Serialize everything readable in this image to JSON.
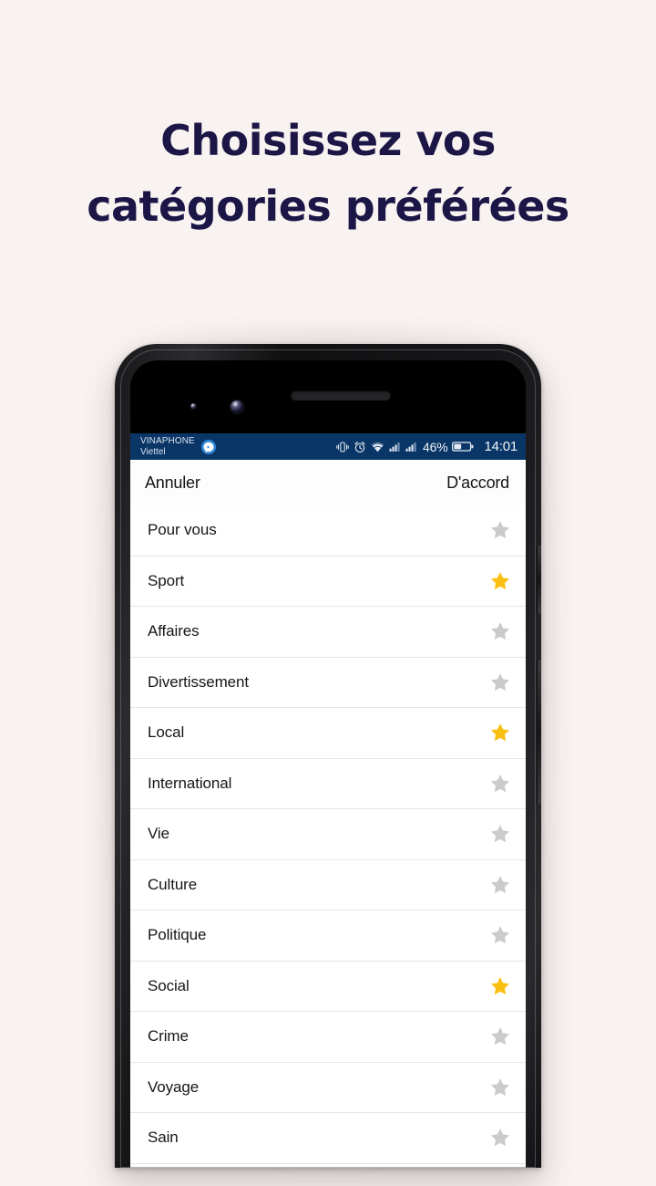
{
  "promo": {
    "heading_line1": "Choisissez vos",
    "heading_line2": "catégories préférées",
    "heading_color": "#1b1646",
    "background_color": "#f8f2f1"
  },
  "phone": {
    "status_bar": {
      "background_color": "#0a3667",
      "carrier_primary": "VINAPHONE",
      "carrier_secondary": "Viettel",
      "messenger_icon": "messenger-icon",
      "icons": [
        "vibrate-icon",
        "alarm-icon",
        "wifi-icon",
        "signal-icon",
        "signal-icon"
      ],
      "battery_percent": "46%",
      "battery_icon": "battery-icon",
      "clock": "14:01"
    },
    "nav_bar": {
      "cancel_label": "Annuler",
      "confirm_label": "D'accord"
    },
    "list": {
      "star_selected_color": "#f9c013",
      "star_unselected_color": "#cbcbcb",
      "items": [
        {
          "label": "Pour vous",
          "selected": false
        },
        {
          "label": "Sport",
          "selected": true
        },
        {
          "label": "Affaires",
          "selected": false
        },
        {
          "label": "Divertissement",
          "selected": false
        },
        {
          "label": "Local",
          "selected": true
        },
        {
          "label": "International",
          "selected": false
        },
        {
          "label": "Vie",
          "selected": false
        },
        {
          "label": "Culture",
          "selected": false
        },
        {
          "label": "Politique",
          "selected": false
        },
        {
          "label": "Social",
          "selected": true
        },
        {
          "label": "Crime",
          "selected": false
        },
        {
          "label": "Voyage",
          "selected": false
        },
        {
          "label": "Sain",
          "selected": false
        }
      ]
    }
  }
}
